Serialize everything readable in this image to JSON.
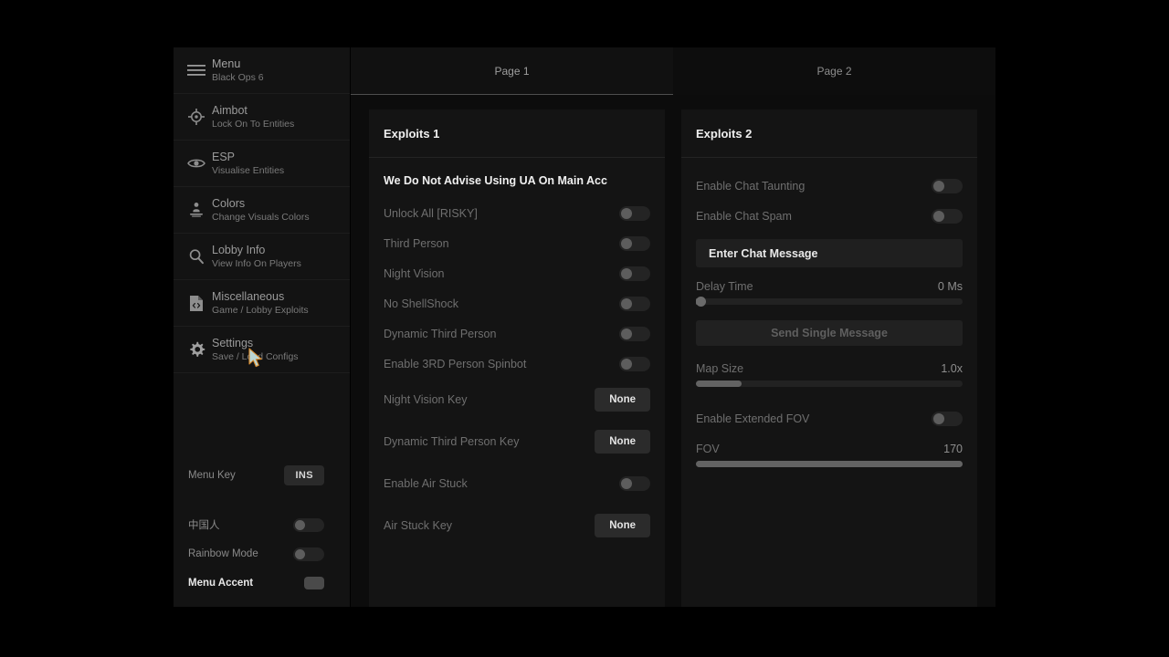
{
  "accent_color": "#16323e",
  "sidebar": {
    "header": {
      "icon": "hamburger-icon",
      "title": "Menu",
      "subtitle": "Black Ops 6"
    },
    "items": [
      {
        "icon": "crosshair-icon",
        "title": "Aimbot",
        "subtitle": "Lock On To Entities"
      },
      {
        "icon": "eye-icon",
        "title": "ESP",
        "subtitle": "Visualise Entities"
      },
      {
        "icon": "palette-person-icon",
        "title": "Colors",
        "subtitle": "Change Visuals Colors"
      },
      {
        "icon": "magnifier-icon",
        "title": "Lobby Info",
        "subtitle": "View Info On Players"
      },
      {
        "icon": "file-code-icon",
        "title": "Miscellaneous",
        "subtitle": "Game / Lobby Exploits"
      },
      {
        "icon": "gear-icon",
        "title": "Settings",
        "subtitle": "Save / Load Configs"
      }
    ],
    "controls": [
      {
        "label": "Menu Key",
        "type": "key",
        "value": "INS"
      },
      {
        "label": "中国人",
        "type": "toggle",
        "value": "off"
      },
      {
        "label": "Rainbow Mode",
        "type": "toggle",
        "value": "off"
      },
      {
        "label": "Menu Accent",
        "type": "swatch",
        "value": "#4a4a4a"
      }
    ]
  },
  "tabs": [
    {
      "label": "Page 1",
      "active": true
    },
    {
      "label": "Page 2",
      "active": false
    }
  ],
  "panel1": {
    "title": "Exploits 1",
    "note": "We Do Not Advise Using UA On Main Acc",
    "rows": [
      {
        "label": "Unlock All [RISKY]",
        "type": "toggle",
        "value": "off"
      },
      {
        "label": "Third Person",
        "type": "toggle",
        "value": "off"
      },
      {
        "label": "Night Vision",
        "type": "toggle",
        "value": "off"
      },
      {
        "label": "No ShellShock",
        "type": "toggle",
        "value": "off"
      },
      {
        "label": "Dynamic Third Person",
        "type": "toggle",
        "value": "off"
      },
      {
        "label": "Enable 3RD Person Spinbot",
        "type": "toggle",
        "value": "off"
      },
      {
        "label": "Night Vision Key",
        "type": "key",
        "value": "None"
      },
      {
        "label": "Dynamic Third Person Key",
        "type": "key",
        "value": "None"
      },
      {
        "label": "Enable Air Stuck",
        "type": "toggle",
        "value": "off"
      },
      {
        "label": "Air Stuck Key",
        "type": "key",
        "value": "None"
      }
    ]
  },
  "panel2": {
    "title": "Exploits 2",
    "chat_taunting_label": "Enable Chat Taunting",
    "chat_taunting_value": "off",
    "chat_spam_label": "Enable Chat Spam",
    "chat_spam_value": "off",
    "chat_message_placeholder": "Enter Chat Message",
    "chat_message_value": "Enter Chat Message",
    "delay_label": "Delay Time",
    "delay_value": "0 Ms",
    "delay_percent": 0,
    "send_button": "Send Single Message",
    "map_size_label": "Map Size",
    "map_size_value": "1.0x",
    "map_size_percent": 17,
    "extended_fov_label": "Enable Extended FOV",
    "extended_fov_value": "off",
    "fov_label": "FOV",
    "fov_value": "170",
    "fov_percent": 100
  }
}
